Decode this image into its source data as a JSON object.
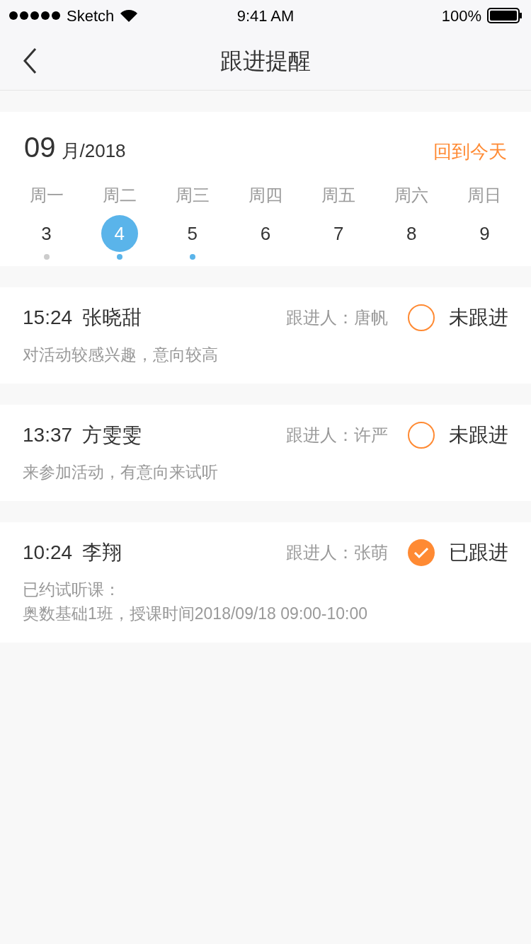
{
  "status_bar": {
    "carrier": "Sketch",
    "time": "9:41 AM",
    "battery": "100%"
  },
  "nav": {
    "title": "跟进提醒"
  },
  "calendar": {
    "month": "09",
    "month_suffix": "月/2018",
    "today_link": "回到今天",
    "days": [
      {
        "weekday": "周一",
        "date": "3",
        "selected": false,
        "color": "#cccccc"
      },
      {
        "weekday": "周二",
        "date": "4",
        "selected": true,
        "color": "#5ab4ea"
      },
      {
        "weekday": "周三",
        "date": "5",
        "selected": false,
        "color": "#5ab4ea"
      },
      {
        "weekday": "周四",
        "date": "6",
        "selected": false
      },
      {
        "weekday": "周五",
        "date": "7",
        "selected": false
      },
      {
        "weekday": "周六",
        "date": "8",
        "selected": false
      },
      {
        "weekday": "周日",
        "date": "9",
        "selected": false
      }
    ]
  },
  "reminders": [
    {
      "time": "15:24",
      "name": "张晓甜",
      "follower_label": "跟进人：",
      "follower": "唐帆",
      "checked": false,
      "status": "未跟进",
      "notes": [
        "对活动较感兴趣，意向较高"
      ]
    },
    {
      "time": "13:37",
      "name": "方雯雯",
      "follower_label": "跟进人：",
      "follower": "许严",
      "checked": false,
      "status": "未跟进",
      "notes": [
        "来参加活动，有意向来试听"
      ]
    },
    {
      "time": "10:24",
      "name": "李翔",
      "follower_label": "跟进人：",
      "follower": "张萌",
      "checked": true,
      "status": "已跟进",
      "notes": [
        "已约试听课：",
        "奥数基础1班，授课时间2018/09/18 09:00-10:00"
      ]
    }
  ]
}
